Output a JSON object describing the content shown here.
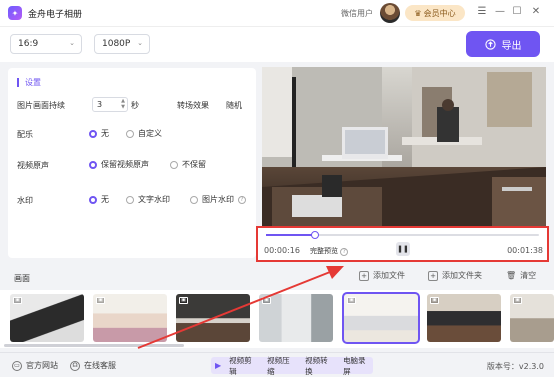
{
  "app": {
    "title": "金舟电子相册",
    "logo_icon": "album-logo-icon"
  },
  "header": {
    "user_name": "微信用户",
    "vip_label": "会员中心"
  },
  "window_controls": {
    "menu": "☰",
    "minimize": "—",
    "maximize": "☐",
    "close": "✕"
  },
  "toolbar": {
    "ratio": "16:9",
    "resolution": "1080P",
    "export_label": "导出"
  },
  "settings": {
    "title": "设置",
    "duration_label": "图片画面持续",
    "duration_value": "3",
    "duration_unit": "秒",
    "transition_label": "转场效果",
    "transition_value": "随机",
    "music_label": "配乐",
    "music_options": [
      "无",
      "自定义"
    ],
    "audio_label": "视频原声",
    "audio_options": [
      "保留视频原声",
      "不保留"
    ],
    "watermark_label": "水印",
    "watermark_options": [
      "无",
      "文字水印",
      "图片水印"
    ]
  },
  "player": {
    "current_time": "00:00:16",
    "total_time": "00:01:38",
    "full_preview_label": "完整预览",
    "progress": 0.18
  },
  "timeline": {
    "title": "画面",
    "add_file": "添加文件",
    "add_folder": "添加文件夹",
    "clear": "清空",
    "selected_index": 4
  },
  "status": {
    "website": "官方网站",
    "support": "在线客服",
    "tools": [
      "视频剪辑",
      "视频压缩",
      "视频转换",
      "电脑录屏"
    ],
    "version": "版本号：v2.3.0"
  },
  "colors": {
    "accent": "#6f55f2",
    "highlight_box": "#e53935",
    "arrow": "#e53935"
  }
}
